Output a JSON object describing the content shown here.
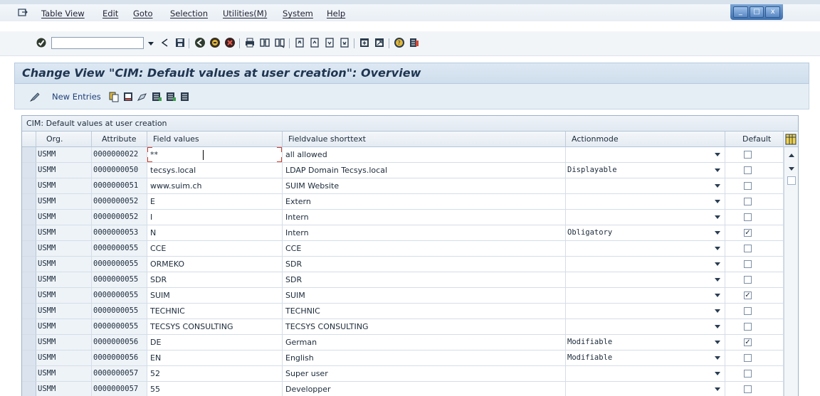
{
  "menubar": {
    "items": [
      "Table View",
      "Edit",
      "Goto",
      "Selection",
      "Utilities(M)",
      "System",
      "Help"
    ],
    "window_buttons": [
      "_",
      "□",
      "x"
    ]
  },
  "toolbar": {
    "command_field": "",
    "icons": [
      "enter-icon",
      "dropdown-icon",
      "back-arrow-icon",
      "save-icon",
      "green-back-icon",
      "exit-icon",
      "cancel-icon",
      "print-icon",
      "find-icon",
      "find-next-icon",
      "first-page-icon",
      "prev-page-icon",
      "next-page-icon",
      "last-page-icon",
      "create-session-icon",
      "shortcut-icon",
      "help-icon",
      "customize-layout-icon"
    ]
  },
  "screen": {
    "title": "Change View \"CIM: Default values at user creation\": Overview",
    "new_entries_label": "New Entries"
  },
  "table": {
    "caption": "CIM: Default values at user creation",
    "columns": [
      "Org.",
      "Attribute",
      "Field values",
      "Fieldvalue shorttext",
      "Actionmode",
      "Default"
    ],
    "rows": [
      {
        "org": "USMM",
        "attribute": "0000000022",
        "field_value": "**",
        "shorttext": "all allowed",
        "actionmode": "",
        "default": ""
      },
      {
        "org": "USMM",
        "attribute": "0000000050",
        "field_value": "tecsys.local",
        "shorttext": "LDAP Domain Tecsys.local",
        "actionmode": "Displayable",
        "default": ""
      },
      {
        "org": "USMM",
        "attribute": "0000000051",
        "field_value": "www.suim.ch",
        "shorttext": "SUIM Website",
        "actionmode": "",
        "default": ""
      },
      {
        "org": "USMM",
        "attribute": "0000000052",
        "field_value": "E",
        "shorttext": "Extern",
        "actionmode": "",
        "default": ""
      },
      {
        "org": "USMM",
        "attribute": "0000000052",
        "field_value": "I",
        "shorttext": "Intern",
        "actionmode": "",
        "default": ""
      },
      {
        "org": "USMM",
        "attribute": "0000000053",
        "field_value": "N",
        "shorttext": "Intern",
        "actionmode": "Obligatory",
        "default": "✓"
      },
      {
        "org": "USMM",
        "attribute": "0000000055",
        "field_value": "CCE",
        "shorttext": "CCE",
        "actionmode": "",
        "default": ""
      },
      {
        "org": "USMM",
        "attribute": "0000000055",
        "field_value": "ORMEKO",
        "shorttext": "SDR",
        "actionmode": "",
        "default": ""
      },
      {
        "org": "USMM",
        "attribute": "0000000055",
        "field_value": "SDR",
        "shorttext": "SDR",
        "actionmode": "",
        "default": ""
      },
      {
        "org": "USMM",
        "attribute": "0000000055",
        "field_value": "SUIM",
        "shorttext": "SUIM",
        "actionmode": "",
        "default": "✓"
      },
      {
        "org": "USMM",
        "attribute": "0000000055",
        "field_value": "TECHNIC",
        "shorttext": "TECHNIC",
        "actionmode": "",
        "default": ""
      },
      {
        "org": "USMM",
        "attribute": "0000000055",
        "field_value": "TECSYS CONSULTING",
        "shorttext": "TECSYS CONSULTING",
        "actionmode": "",
        "default": ""
      },
      {
        "org": "USMM",
        "attribute": "0000000056",
        "field_value": "DE",
        "shorttext": "German",
        "actionmode": "Modifiable",
        "default": "✓"
      },
      {
        "org": "USMM",
        "attribute": "0000000056",
        "field_value": "EN",
        "shorttext": "English",
        "actionmode": "Modifiable",
        "default": ""
      },
      {
        "org": "USMM",
        "attribute": "0000000057",
        "field_value": "52",
        "shorttext": "Super user",
        "actionmode": "",
        "default": ""
      },
      {
        "org": "USMM",
        "attribute": "0000000057",
        "field_value": "55",
        "shorttext": "Developper",
        "actionmode": "",
        "default": ""
      }
    ]
  },
  "colors": {
    "title_bg": "#d6e3f0",
    "accent": "#1f3550",
    "error_mark": "#d23b2a"
  }
}
